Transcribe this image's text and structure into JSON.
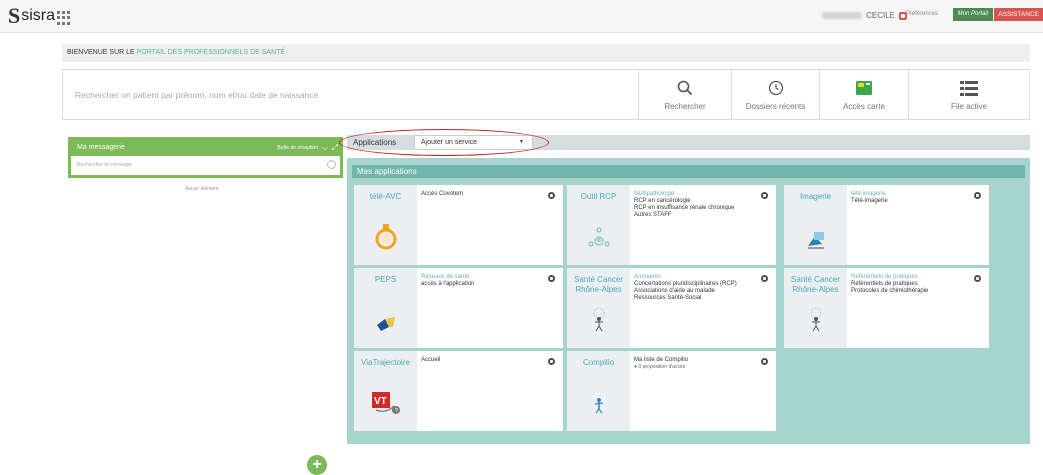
{
  "topbar": {
    "logo": {
      "mark": "S",
      "text": "sisra"
    },
    "user_name": "CECILE",
    "preferences_label": "Préférences",
    "mon_portail_label": "Mon Portail",
    "assistance_label": "ASSISTANCE",
    "colors": {
      "accent_green": "#4d8b55",
      "danger_red": "#d9534f"
    }
  },
  "welcome": {
    "prefix": "BIENVENUE SUR LE",
    "highlight": "PORTAIL DES PROFESSIONNELS DE SANTÉ"
  },
  "search": {
    "placeholder": "Rechercher un patient par prénom, nom et/ou date de naissance",
    "tools": [
      {
        "label": "Rechercher",
        "icon": "search-icon"
      },
      {
        "label": "Dossiers récents",
        "icon": "history-icon"
      },
      {
        "label": "Accès carte",
        "icon": "card-icon"
      },
      {
        "label": "File active",
        "icon": "list-icon"
      }
    ]
  },
  "messagerie": {
    "title": "Ma messagerie",
    "reception_label": "Boîte de réception",
    "search_placeholder": "Rechercher un message",
    "empty_label": "Aucun élément"
  },
  "tabs": {
    "active": "Applications",
    "select_value": "Ajouter un service"
  },
  "applications": {
    "header": "Mes applications",
    "cards": [
      {
        "name": "télé-AVC",
        "title": "",
        "lines": [
          "Accès Covotem"
        ],
        "icon": "ring-icon"
      },
      {
        "name": "Outil RCP",
        "title": "Multipathologie",
        "lines": [
          "RCP en cancérologie",
          "RCP en insuffisance rénale chronique",
          "Autres STAFF"
        ],
        "icon": "team-icon"
      },
      {
        "name": "Imagerie",
        "title": "télé-imagerie",
        "lines": [
          "Télé-imagerie"
        ],
        "icon": "imaging-icon"
      },
      {
        "name": "PEPS",
        "title": "Réseaux de santé",
        "lines": [
          "accès à l'application"
        ],
        "icon": "peps-icon"
      },
      {
        "name": "Santé Cancer Rhône-Alpes",
        "title": "Annuaires",
        "lines": [
          "Concertations pluridisciplinaires (RCP)",
          "Associations d'aide au malade",
          "Ressources Santé-Social"
        ],
        "icon": "figure-icon"
      },
      {
        "name": "Santé Cancer Rhône-Alpes",
        "title": "Référentiels de pratiques",
        "lines": [
          "Référentiels de pratiques",
          "Protocoles de chimiothérapie"
        ],
        "icon": "figure-icon"
      },
      {
        "name": "ViaTrajectoire",
        "title": "",
        "lines": [
          "Accueil"
        ],
        "icon": "vt-icon"
      },
      {
        "name": "Compilio",
        "title": "",
        "lines": [
          "Ma liste de Compilio"
        ],
        "note": "0 proposition d'accès",
        "icon": "compilio-icon"
      }
    ]
  },
  "add_button_label": "+"
}
